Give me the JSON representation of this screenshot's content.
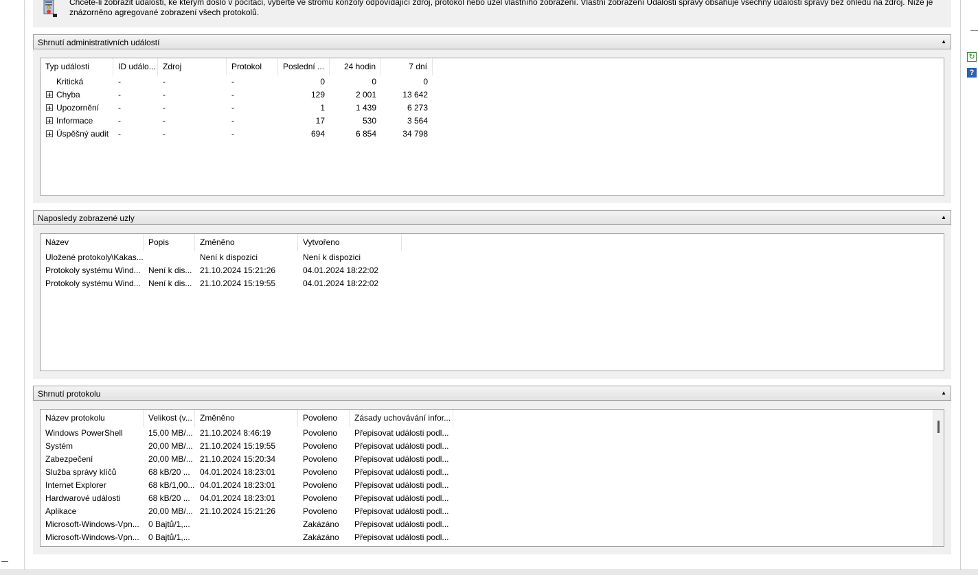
{
  "intro": {
    "text": "Chcete-li zobrazit události, ke kterým došlo v počítači, vyberte ve stromu konzoly odpovídající zdroj, protokol nebo uzel vlastního zobrazení. Vlastní zobrazení Události správy obsahuje všechny události správy bez ohledu na zdroj. Níže je znázorněno agregované zobrazení všech protokolů."
  },
  "admin_summary": {
    "title": "Shrnutí administrativních událostí",
    "columns": [
      "Typ události",
      "ID událo...",
      "Zdroj",
      "Protokol",
      "Poslední ...",
      "24 hodin",
      "7 dní"
    ],
    "rows": [
      {
        "type": "Kritická",
        "expandable": false,
        "id": "-",
        "source": "-",
        "log": "-",
        "last": "0",
        "h24": "0",
        "d7": "0"
      },
      {
        "type": "Chyba",
        "expandable": true,
        "id": "-",
        "source": "-",
        "log": "-",
        "last": "129",
        "h24": "2 001",
        "d7": "13 642"
      },
      {
        "type": "Upozornění",
        "expandable": true,
        "id": "-",
        "source": "-",
        "log": "-",
        "last": "1",
        "h24": "1 439",
        "d7": "6 273"
      },
      {
        "type": "Informace",
        "expandable": true,
        "id": "-",
        "source": "-",
        "log": "-",
        "last": "17",
        "h24": "530",
        "d7": "3 564"
      },
      {
        "type": "Úspěšný audit",
        "expandable": true,
        "id": "-",
        "source": "-",
        "log": "-",
        "last": "694",
        "h24": "6 854",
        "d7": "34 798"
      }
    ]
  },
  "recent_nodes": {
    "title": "Naposledy zobrazené uzly",
    "columns": [
      "Název",
      "Popis",
      "Změněno",
      "Vytvořeno"
    ],
    "rows": [
      {
        "name": "Uložené protokoly\\Kakas...",
        "desc": "",
        "modified": "Není k dispozici",
        "created": "Není k dispozici"
      },
      {
        "name": "Protokoly systému Wind...",
        "desc": "Není k dis...",
        "modified": "21.10.2024 15:21:26",
        "created": "04.01.2024 18:22:02"
      },
      {
        "name": "Protokoly systému Wind...",
        "desc": "Není k dis...",
        "modified": "21.10.2024 15:19:55",
        "created": "04.01.2024 18:22:02"
      }
    ]
  },
  "log_summary": {
    "title": "Shrnutí protokolu",
    "columns": [
      "Název protokolu",
      "Velikost (v...",
      "Změněno",
      "Povoleno",
      "Zásady uchovávání infor..."
    ],
    "rows": [
      {
        "name": "Windows PowerShell",
        "size": "15,00 MB/...",
        "modified": "21.10.2024 8:46:19",
        "enabled": "Povoleno",
        "retention": "Přepisovat události podl..."
      },
      {
        "name": "Systém",
        "size": "20,00 MB/...",
        "modified": "21.10.2024 15:19:55",
        "enabled": "Povoleno",
        "retention": "Přepisovat události podl..."
      },
      {
        "name": "Zabezpečení",
        "size": "20,00 MB/...",
        "modified": "21.10.2024 15:20:34",
        "enabled": "Povoleno",
        "retention": "Přepisovat události podl..."
      },
      {
        "name": "Služba správy klíčů",
        "size": "68 kB/20 ...",
        "modified": "04.01.2024 18:23:01",
        "enabled": "Povoleno",
        "retention": "Přepisovat události podl..."
      },
      {
        "name": "Internet Explorer",
        "size": "68 kB/1,00...",
        "modified": "04.01.2024 18:23:01",
        "enabled": "Povoleno",
        "retention": "Přepisovat události podl..."
      },
      {
        "name": "Hardwarové události",
        "size": "68 kB/20 ...",
        "modified": "04.01.2024 18:23:01",
        "enabled": "Povoleno",
        "retention": "Přepisovat události podl..."
      },
      {
        "name": "Aplikace",
        "size": "20,00 MB/...",
        "modified": "21.10.2024 15:21:26",
        "enabled": "Povoleno",
        "retention": "Přepisovat události podl..."
      },
      {
        "name": "Microsoft-Windows-Vpn...",
        "size": "0 Bajtů/1,...",
        "modified": "",
        "enabled": "Zakázáno",
        "retention": "Přepisovat události podl..."
      },
      {
        "name": "Microsoft-Windows-Vpn...",
        "size": "0 Bajtů/1,...",
        "modified": "",
        "enabled": "Zakázáno",
        "retention": "Přepisovat události podl..."
      }
    ]
  },
  "icons": {
    "intro": "event-viewer-icon",
    "collapse": "collapse-arrow-icon",
    "expand": "plus-expander-icon",
    "refresh": "refresh-icon",
    "help": "help-icon"
  }
}
